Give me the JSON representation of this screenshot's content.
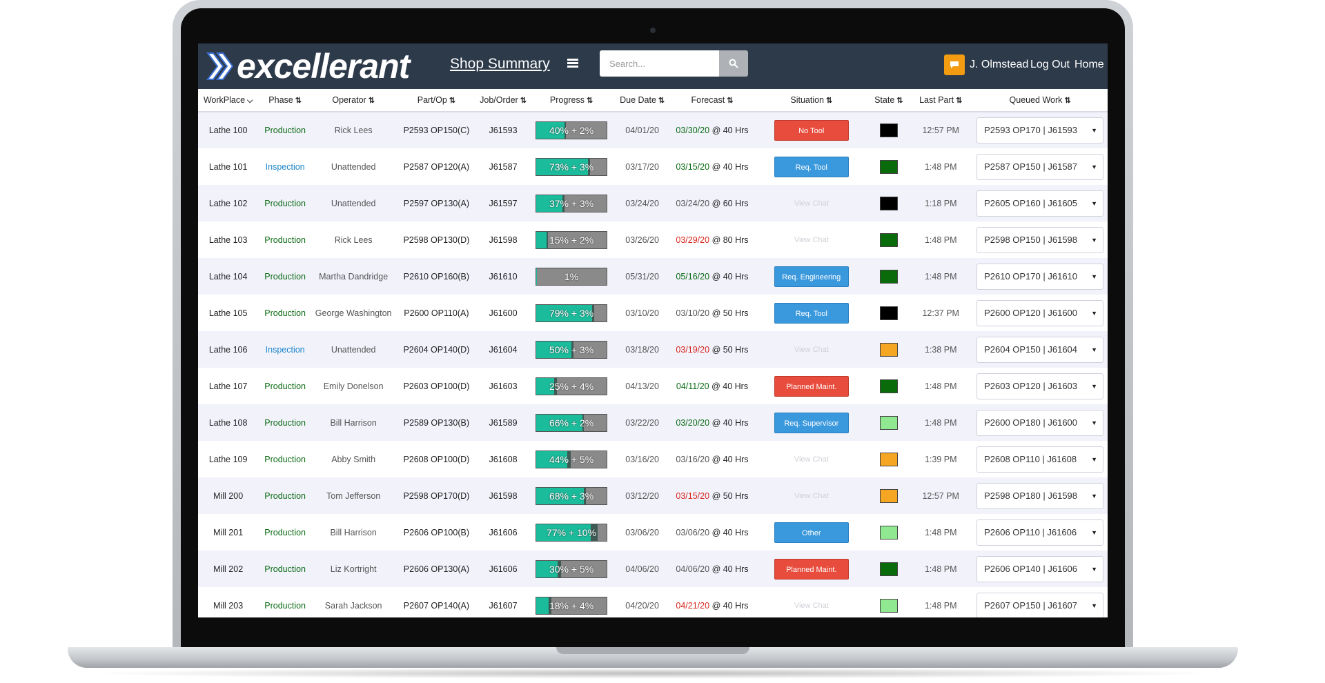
{
  "app": {
    "logo_text": "excellerant",
    "page_title": "Shop Summary",
    "search": {
      "placeholder": "Search..."
    },
    "user": {
      "name": "J. Olmstead"
    },
    "nav": {
      "logout": "Log Out",
      "home": "Home"
    }
  },
  "colors": {
    "header_bg": "#2d3a4a",
    "progress_fill": "#1abc9c",
    "situation_red": "#e74c3c",
    "situation_blue": "#3a98dc",
    "chat_orange": "#f39c12"
  },
  "table": {
    "headers": [
      "WorkPlace",
      "Phase",
      "Operator",
      "Part/Op",
      "Job/Order",
      "Progress",
      "Due Date",
      "Forecast",
      "Situation",
      "State",
      "Last Part",
      "Queued Work"
    ],
    "rows": [
      {
        "workplace": "Lathe 100",
        "phase": "Production",
        "phase_type": "production",
        "operator": "Rick Lees",
        "part": "P2593 OP150(C)",
        "job": "J61593",
        "progress": "40% + 2%",
        "progress_pct": 40,
        "progress_ext": 2,
        "due": "04/01/20",
        "forecast_date": "03/30/20",
        "forecast_color": "green",
        "forecast_hrs": "@ 40 Hrs",
        "situation": "No Tool",
        "situation_type": "red",
        "state_color": "#000000",
        "last_part": "12:57 PM",
        "queued": "P2593 OP170 | J61593"
      },
      {
        "workplace": "Lathe 101",
        "phase": "Inspection",
        "phase_type": "inspection",
        "operator": "Unattended",
        "part": "P2587 OP120(A)",
        "job": "J61587",
        "progress": "73% + 3%",
        "progress_pct": 73,
        "progress_ext": 3,
        "due": "03/17/20",
        "forecast_date": "03/15/20",
        "forecast_color": "green",
        "forecast_hrs": "@ 40 Hrs",
        "situation": "Req. Tool",
        "situation_type": "blue",
        "state_color": "#0a6b0a",
        "last_part": "1:48 PM",
        "queued": "P2587 OP150 | J61587"
      },
      {
        "workplace": "Lathe 102",
        "phase": "Production",
        "phase_type": "production",
        "operator": "Unattended",
        "part": "P2597 OP130(A)",
        "job": "J61597",
        "progress": "37% + 3%",
        "progress_pct": 37,
        "progress_ext": 3,
        "due": "03/24/20",
        "forecast_date": "03/24/20",
        "forecast_color": "gray",
        "forecast_hrs": "@ 60 Hrs",
        "situation": "View Chat",
        "situation_type": "none",
        "state_color": "#000000",
        "last_part": "1:18 PM",
        "queued": "P2605 OP160 | J61605"
      },
      {
        "workplace": "Lathe 103",
        "phase": "Production",
        "phase_type": "production",
        "operator": "Rick Lees",
        "part": "P2598 OP130(D)",
        "job": "J61598",
        "progress": "15% + 2%",
        "progress_pct": 15,
        "progress_ext": 2,
        "due": "03/26/20",
        "forecast_date": "03/29/20",
        "forecast_color": "red",
        "forecast_hrs": "@ 80 Hrs",
        "situation": "View Chat",
        "situation_type": "none",
        "state_color": "#0a6b0a",
        "last_part": "1:48 PM",
        "queued": "P2598 OP150 | J61598"
      },
      {
        "workplace": "Lathe 104",
        "phase": "Production",
        "phase_type": "production",
        "operator": "Martha Dandridge",
        "part": "P2610 OP160(B)",
        "job": "J61610",
        "progress": "1%",
        "progress_pct": 1,
        "progress_ext": 0,
        "due": "05/31/20",
        "forecast_date": "05/16/20",
        "forecast_color": "green",
        "forecast_hrs": "@ 40 Hrs",
        "situation": "Req. Engineering",
        "situation_type": "blue",
        "state_color": "#0a6b0a",
        "last_part": "1:48 PM",
        "queued": "P2610 OP170 | J61610"
      },
      {
        "workplace": "Lathe 105",
        "phase": "Production",
        "phase_type": "production",
        "operator": "George Washington",
        "part": "P2600 OP110(A)",
        "job": "J61600",
        "progress": "79% + 3%",
        "progress_pct": 79,
        "progress_ext": 3,
        "due": "03/10/20",
        "forecast_date": "03/10/20",
        "forecast_color": "gray",
        "forecast_hrs": "@ 50 Hrs",
        "situation": "Req. Tool",
        "situation_type": "blue",
        "state_color": "#000000",
        "last_part": "12:37 PM",
        "queued": "P2600 OP120 | J61600"
      },
      {
        "workplace": "Lathe 106",
        "phase": "Inspection",
        "phase_type": "inspection",
        "operator": "Unattended",
        "part": "P2604 OP140(D)",
        "job": "J61604",
        "progress": "50% + 3%",
        "progress_pct": 50,
        "progress_ext": 3,
        "due": "03/18/20",
        "forecast_date": "03/19/20",
        "forecast_color": "red",
        "forecast_hrs": "@ 50 Hrs",
        "situation": "View Chat",
        "situation_type": "none",
        "state_color": "#f5a623",
        "last_part": "1:38 PM",
        "queued": "P2604 OP150 | J61604"
      },
      {
        "workplace": "Lathe 107",
        "phase": "Production",
        "phase_type": "production",
        "operator": "Emily Donelson",
        "part": "P2603 OP100(D)",
        "job": "J61603",
        "progress": "25% + 4%",
        "progress_pct": 25,
        "progress_ext": 4,
        "due": "04/13/20",
        "forecast_date": "04/11/20",
        "forecast_color": "green",
        "forecast_hrs": "@ 40 Hrs",
        "situation": "Planned Maint.",
        "situation_type": "red",
        "state_color": "#0a6b0a",
        "last_part": "1:48 PM",
        "queued": "P2603 OP120 | J61603"
      },
      {
        "workplace": "Lathe 108",
        "phase": "Production",
        "phase_type": "production",
        "operator": "Bill Harrison",
        "part": "P2589 OP130(B)",
        "job": "J61589",
        "progress": "66% + 2%",
        "progress_pct": 66,
        "progress_ext": 2,
        "due": "03/22/20",
        "forecast_date": "03/20/20",
        "forecast_color": "green",
        "forecast_hrs": "@ 40 Hrs",
        "situation": "Req. Supervisor",
        "situation_type": "blue",
        "state_color": "#90e890",
        "last_part": "1:48 PM",
        "queued": "P2600 OP180 | J61600"
      },
      {
        "workplace": "Lathe 109",
        "phase": "Production",
        "phase_type": "production",
        "operator": "Abby Smith",
        "part": "P2608 OP100(D)",
        "job": "J61608",
        "progress": "44% + 5%",
        "progress_pct": 44,
        "progress_ext": 5,
        "due": "03/16/20",
        "forecast_date": "03/16/20",
        "forecast_color": "gray",
        "forecast_hrs": "@ 40 Hrs",
        "situation": "View Chat",
        "situation_type": "none",
        "state_color": "#f5a623",
        "last_part": "1:39 PM",
        "queued": "P2608 OP110 | J61608"
      },
      {
        "workplace": "Mill 200",
        "phase": "Production",
        "phase_type": "production",
        "operator": "Tom Jefferson",
        "part": "P2598 OP170(D)",
        "job": "J61598",
        "progress": "68% + 3%",
        "progress_pct": 68,
        "progress_ext": 3,
        "due": "03/12/20",
        "forecast_date": "03/15/20",
        "forecast_color": "red",
        "forecast_hrs": "@ 50 Hrs",
        "situation": "View Chat",
        "situation_type": "none",
        "state_color": "#f5a623",
        "last_part": "12:57 PM",
        "queued": "P2598 OP180 | J61598"
      },
      {
        "workplace": "Mill 201",
        "phase": "Production",
        "phase_type": "production",
        "operator": "Bill Harrison",
        "part": "P2606 OP100(B)",
        "job": "J61606",
        "progress": "77% + 10%",
        "progress_pct": 77,
        "progress_ext": 10,
        "due": "03/06/20",
        "forecast_date": "03/06/20",
        "forecast_color": "gray",
        "forecast_hrs": "@ 40 Hrs",
        "situation": "Other",
        "situation_type": "blue",
        "state_color": "#90e890",
        "last_part": "1:48 PM",
        "queued": "P2606 OP110 | J61606"
      },
      {
        "workplace": "Mill 202",
        "phase": "Production",
        "phase_type": "production",
        "operator": "Liz Kortright",
        "part": "P2606 OP130(A)",
        "job": "J61606",
        "progress": "30% + 5%",
        "progress_pct": 30,
        "progress_ext": 5,
        "due": "04/06/20",
        "forecast_date": "04/06/20",
        "forecast_color": "gray",
        "forecast_hrs": "@ 40 Hrs",
        "situation": "Planned Maint.",
        "situation_type": "red",
        "state_color": "#0a6b0a",
        "last_part": "1:48 PM",
        "queued": "P2606 OP140 | J61606"
      },
      {
        "workplace": "Mill 203",
        "phase": "Production",
        "phase_type": "production",
        "operator": "Sarah Jackson",
        "part": "P2607 OP140(A)",
        "job": "J61607",
        "progress": "18% + 4%",
        "progress_pct": 18,
        "progress_ext": 4,
        "due": "04/20/20",
        "forecast_date": "04/21/20",
        "forecast_color": "red",
        "forecast_hrs": "@ 40 Hrs",
        "situation": "View Chat",
        "situation_type": "none",
        "state_color": "#90e890",
        "last_part": "1:48 PM",
        "queued": "P2607 OP150 | J61607"
      }
    ]
  }
}
